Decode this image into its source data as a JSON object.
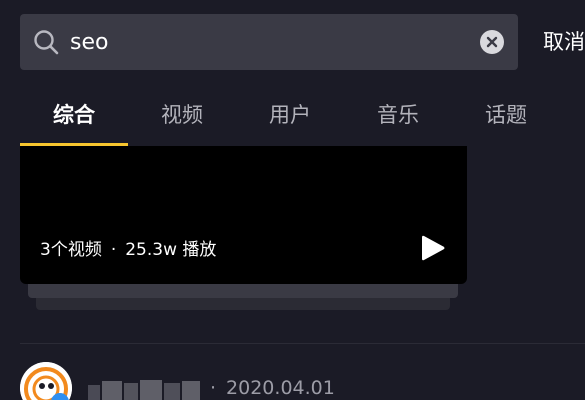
{
  "search": {
    "query": "seo",
    "cancel_label": "取消"
  },
  "tabs": [
    {
      "label": "综合",
      "active": true
    },
    {
      "label": "视频",
      "active": false
    },
    {
      "label": "用户",
      "active": false
    },
    {
      "label": "音乐",
      "active": false
    },
    {
      "label": "话题",
      "active": false
    }
  ],
  "video_card": {
    "count_text": "3个视频",
    "separator": "·",
    "plays_text": "25.3w 播放"
  },
  "post": {
    "separator": "·",
    "date": "2020.04.01"
  },
  "colors": {
    "background": "#1b1b26",
    "search_box": "#3a3a45",
    "accent": "#f7c62f",
    "tab_inactive": "#b3b3bb",
    "date_text": "#9c9ca6"
  },
  "icons": {
    "search": "search-icon",
    "clear": "clear-icon",
    "play": "play-icon"
  }
}
